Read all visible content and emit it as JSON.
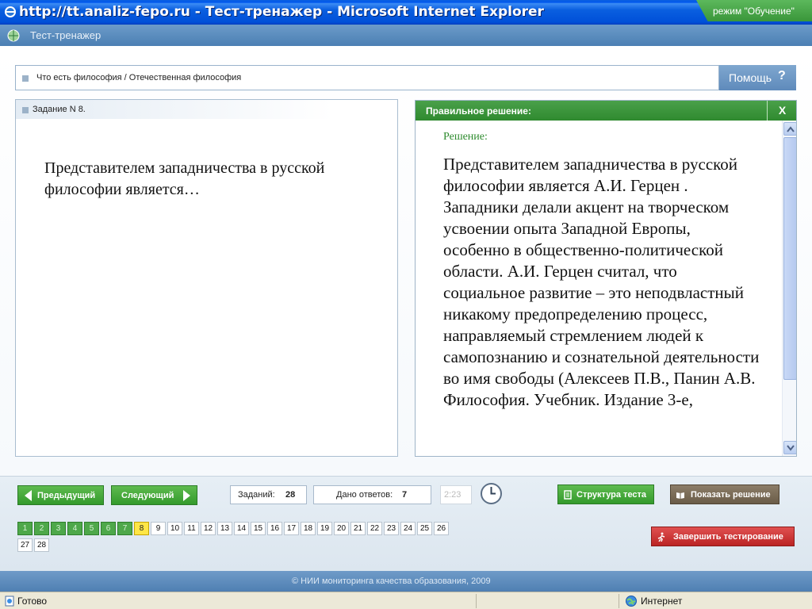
{
  "window": {
    "title": "http://tt.analiz-fepo.ru - Тест-тренажер - Microsoft Internet Explorer"
  },
  "app": {
    "title": "Тест-тренажер",
    "mode": "режим \"Обучение\""
  },
  "topic": {
    "path": "Что есть философия / Отечественная философия"
  },
  "help": {
    "label": "Помощь",
    "icon": "?"
  },
  "task": {
    "number_label": "Задание N 8.",
    "question": "Представителем западничества в русской философии является…"
  },
  "solution": {
    "header": "Правильное решение:",
    "close": "X",
    "subheading": "Решение:",
    "text": "Представителем западничества в русской философии является А.И. Герцен . Западники делали акцент на творческом усвоении опыта Западной Европы, особенно в общественно-политической области. А.И. Герцен считал, что социальное развитие – это неподвластный никакому предопределению процесс, направляемый стремлением людей к самопознанию и сознательной деятельности во имя свободы (Алексеев П.В., Панин А.В. Философия. Учебник. Издание 3-е,"
  },
  "controls": {
    "prev": "Предыдущий",
    "next": "Следующий",
    "tasks_label": "Заданий:",
    "tasks_count": "28",
    "answers_label": "Дано ответов:",
    "answers_count": "7",
    "timer": "2:23",
    "structure": "Структура теста",
    "show_solution": "Показать решение",
    "finish": "Завершить тестирование"
  },
  "task_numbers": {
    "done": [
      "1",
      "2",
      "3",
      "4",
      "5",
      "6",
      "7"
    ],
    "current": "8",
    "rest": [
      "9",
      "10",
      "11",
      "12",
      "13",
      "14",
      "15",
      "16",
      "17",
      "18",
      "19",
      "20",
      "21",
      "22",
      "23",
      "24",
      "25",
      "26",
      "27",
      "28"
    ]
  },
  "footer": {
    "copyright": "© НИИ мониторинга качества образования, 2009"
  },
  "statusbar": {
    "status": "Готово",
    "zone": "Интернет"
  },
  "colors": {
    "green": "#339a2c",
    "blue": "#4f7fb2",
    "current": "#ffe646",
    "red": "#bb2424"
  }
}
